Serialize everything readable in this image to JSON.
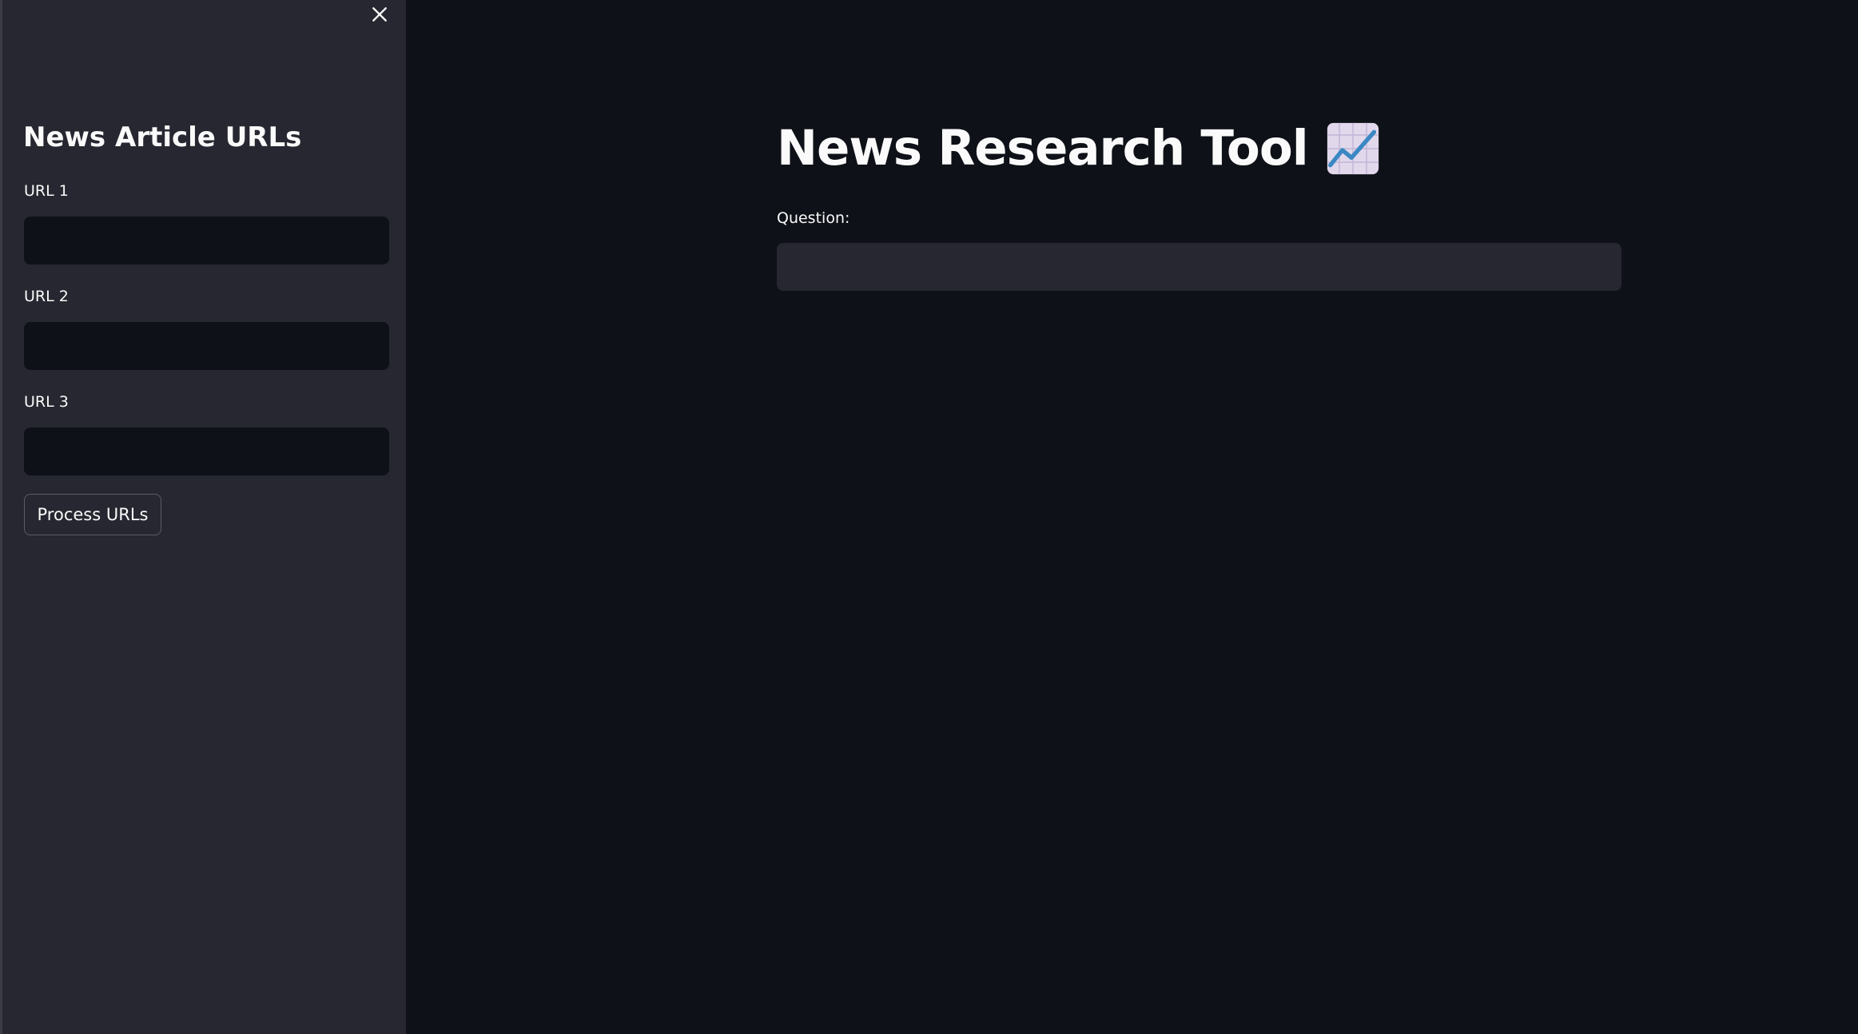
{
  "sidebar": {
    "title": "News Article URLs",
    "close_icon": "close-icon",
    "urls": [
      {
        "label": "URL 1",
        "value": "",
        "placeholder": ""
      },
      {
        "label": "URL 2",
        "value": "",
        "placeholder": ""
      },
      {
        "label": "URL 3",
        "value": "",
        "placeholder": ""
      }
    ],
    "process_button_label": "Process URLs"
  },
  "main": {
    "title": "News Research Tool",
    "title_icon": "chart-increasing-icon",
    "question_label": "Question:",
    "question_value": "",
    "question_placeholder": ""
  },
  "colors": {
    "background": "#0e1117",
    "sidebar_background": "#262730",
    "text": "#fafafa",
    "chart_line": "#3b88c3"
  }
}
